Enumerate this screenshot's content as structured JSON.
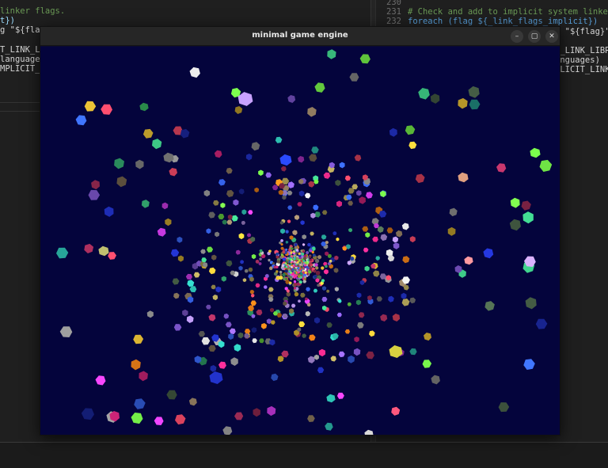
{
  "window": {
    "title": "minimal game engine",
    "minimize_label": "–",
    "maximize_label": "▢",
    "close_label": "✕",
    "minimize_icon": "minimize-icon",
    "maximize_icon": "maximize-icon",
    "close_icon": "close-icon"
  },
  "editor_left": {
    "lines": [
      {
        "text": "linker flags.",
        "class": "c-comment"
      },
      {
        "text": "t})",
        "class": "c-var"
      },
      {
        "text": "g \"${flag}\"",
        "class": "c-plain"
      },
      {
        "text": "",
        "class": "c-plain"
      },
      {
        "text": "T_LINK_LIB",
        "class": "c-plain"
      },
      {
        "text": "languages)",
        "class": "c-plain"
      },
      {
        "text": "MPLICIT_L",
        "class": "c-plain"
      }
    ]
  },
  "editor_right": {
    "lines": [
      {
        "number": "230",
        "text": "",
        "class": "c-plain"
      },
      {
        "number": "231",
        "text": "# Check and add to implicit system linker flags",
        "class": "c-comment"
      },
      {
        "number": "232",
        "text": "foreach (flag ${_link_flags_implicit})",
        "class": "c-keyword"
      },
      {
        "number": "",
        "text": "g \"${flag}\")",
        "class": "c-plain"
      },
      {
        "number": "",
        "text": "",
        "class": "c-plain"
      },
      {
        "number": "",
        "text": "T_LINK_LIBRA",
        "class": "c-plain"
      },
      {
        "number": "",
        "text": "anguages)",
        "class": "c-plain"
      },
      {
        "number": "",
        "text": "PLICIT_LINK",
        "class": "c-plain"
      }
    ]
  },
  "scene": {
    "background": "#04043c",
    "particle_count": 900,
    "palette": [
      "#e040fb",
      "#ff2d95",
      "#3a6bff",
      "#2233cc",
      "#7cff4d",
      "#3fd08a",
      "#ffd23a",
      "#ff8a1a",
      "#d9d9d9",
      "#8a8a8a",
      "#a0896a",
      "#c0b060",
      "#ff4d6d",
      "#9c6bff",
      "#2ec4b6",
      "#c8a2ff",
      "#5a7a5a",
      "#b03060"
    ]
  }
}
